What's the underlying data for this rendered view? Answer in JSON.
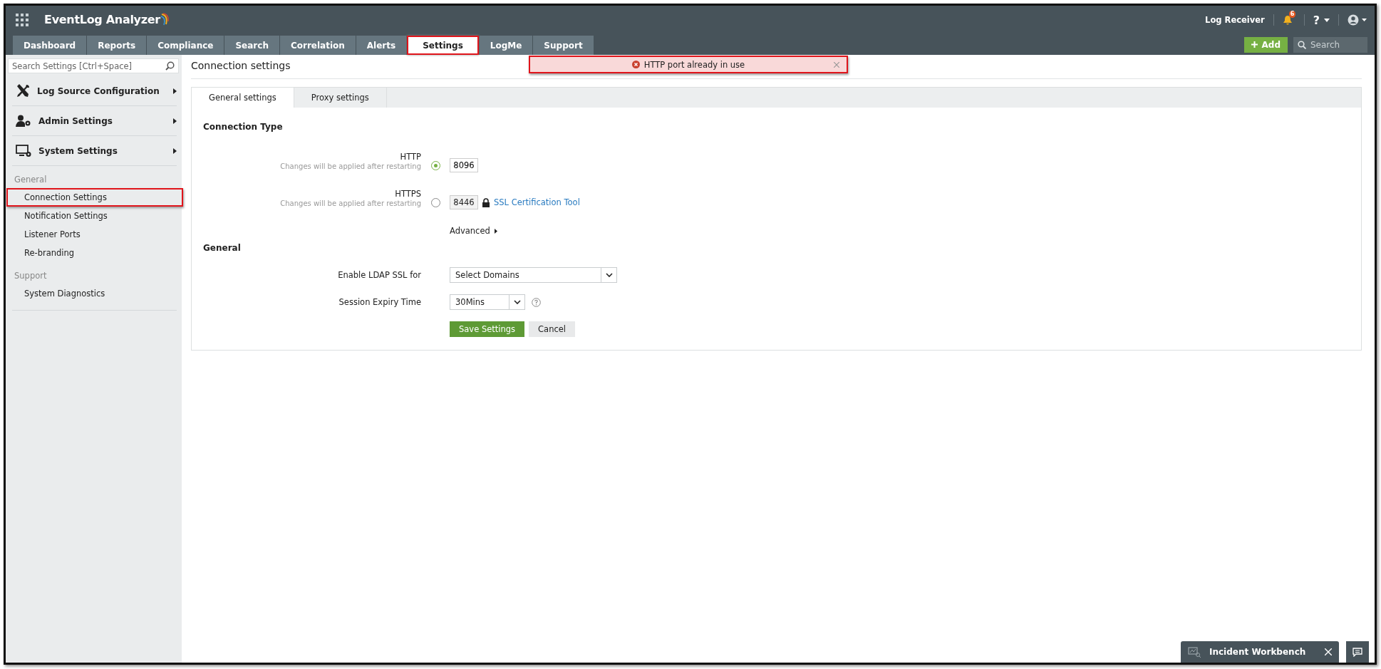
{
  "header": {
    "app_name": "EventLog Analyzer",
    "link": "Log Receiver",
    "notification_count": "6",
    "help": "?",
    "add_button": "Add",
    "search_placeholder": "Search"
  },
  "nav_tabs": [
    {
      "label": "Dashboard",
      "selected": false,
      "highlighted": false
    },
    {
      "label": "Reports",
      "selected": false,
      "highlighted": false
    },
    {
      "label": "Compliance",
      "selected": false,
      "highlighted": false
    },
    {
      "label": "Search",
      "selected": false,
      "highlighted": false
    },
    {
      "label": "Correlation",
      "selected": false,
      "highlighted": false
    },
    {
      "label": "Alerts",
      "selected": false,
      "highlighted": false
    },
    {
      "label": "Settings",
      "selected": true,
      "highlighted": true
    },
    {
      "label": "LogMe",
      "selected": false,
      "highlighted": false
    },
    {
      "label": "Support",
      "selected": false,
      "highlighted": false
    }
  ],
  "toast": {
    "message": "HTTP port already in use",
    "highlighted": true
  },
  "sidebar": {
    "search_placeholder": "Search Settings [Ctrl+Space]",
    "menus": [
      {
        "label": "Log Source Configuration",
        "kind": "tools"
      },
      {
        "label": "Admin Settings",
        "kind": "admin"
      },
      {
        "label": "System Settings",
        "kind": "system"
      }
    ],
    "sections": [
      {
        "title": "General",
        "items": [
          {
            "label": "Connection Settings",
            "highlighted": true
          },
          {
            "label": "Notification Settings",
            "highlighted": false
          },
          {
            "label": "Listener Ports",
            "highlighted": false
          },
          {
            "label": "Re-branding",
            "highlighted": false
          }
        ]
      },
      {
        "title": "Support",
        "items": [
          {
            "label": "System Diagnostics",
            "highlighted": false
          }
        ]
      }
    ]
  },
  "page": {
    "title": "Connection settings",
    "tabs": [
      {
        "label": "General settings",
        "selected": true
      },
      {
        "label": "Proxy settings",
        "selected": false
      }
    ],
    "connection_type": {
      "title": "Connection Type",
      "protocols": [
        {
          "label": "HTTP",
          "hint": "Changes will be applied after restarting",
          "selected": true,
          "port": "8096"
        },
        {
          "label": "HTTPS",
          "hint": "Changes will be applied after restarting",
          "selected": false,
          "port": "8446",
          "link": "SSL Certification Tool"
        }
      ],
      "advanced": "Advanced"
    },
    "general": {
      "title": "General",
      "fields": [
        {
          "label": "Enable LDAP SSL for",
          "value": "Select Domains",
          "kind": "wide"
        },
        {
          "label": "Session Expiry Time",
          "value": "30Mins",
          "kind": "help"
        }
      ]
    },
    "buttons": {
      "save": "Save Settings",
      "cancel": "Cancel"
    }
  },
  "workbench": {
    "label": "Incident Workbench"
  }
}
